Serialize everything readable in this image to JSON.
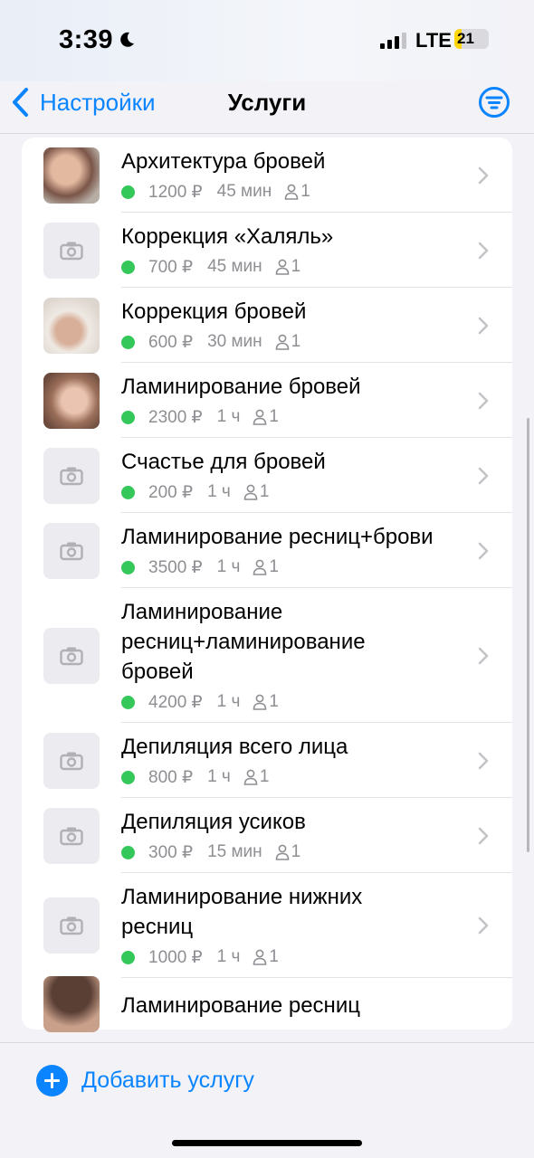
{
  "status": {
    "time": "3:39",
    "network": "LTE",
    "battery": "21",
    "battery_level": 0.21
  },
  "nav": {
    "back_label": "Настройки",
    "title": "Услуги",
    "filter_icon": "filter-icon"
  },
  "services": [
    {
      "name": "Архитектура бровей",
      "price": "1200 ₽",
      "duration": "45 мин",
      "staff": "1",
      "photo": "photo-1"
    },
    {
      "name": "Коррекция «Халяль»",
      "price": "700 ₽",
      "duration": "45 мин",
      "staff": "1",
      "photo": "camera-icon"
    },
    {
      "name": "Коррекция бровей",
      "price": "600 ₽",
      "duration": "30 мин",
      "staff": "1",
      "photo": "photo-2"
    },
    {
      "name": "Ламинирование бровей",
      "price": "2300 ₽",
      "duration": "1 ч",
      "staff": "1",
      "photo": "photo-3"
    },
    {
      "name": "Счастье для бровей",
      "price": "200 ₽",
      "duration": "1 ч",
      "staff": "1",
      "photo": "camera-icon"
    },
    {
      "name": "Ламинирование ресниц+брови",
      "price": "3500 ₽",
      "duration": "1 ч",
      "staff": "1",
      "photo": "camera-icon"
    },
    {
      "name": "Ламинирование ресниц+ламинирование бровей",
      "price": "4200 ₽",
      "duration": "1 ч",
      "staff": "1",
      "photo": "camera-icon"
    },
    {
      "name": "Депиляция всего лица",
      "price": "800 ₽",
      "duration": "1 ч",
      "staff": "1",
      "photo": "camera-icon"
    },
    {
      "name": "Депиляция усиков",
      "price": "300 ₽",
      "duration": "15 мин",
      "staff": "1",
      "photo": "camera-icon"
    },
    {
      "name": "Ламинирование нижних ресниц",
      "price": "1000 ₽",
      "duration": "1 ч",
      "staff": "1",
      "photo": "camera-icon"
    },
    {
      "name": "Ламинирование ресниц",
      "price": "",
      "duration": "",
      "staff": "",
      "photo": "photo-4"
    }
  ],
  "bottom": {
    "add_label": "Добавить услугу"
  },
  "colors": {
    "accent": "#0a84ff",
    "active_dot": "#34c759"
  }
}
